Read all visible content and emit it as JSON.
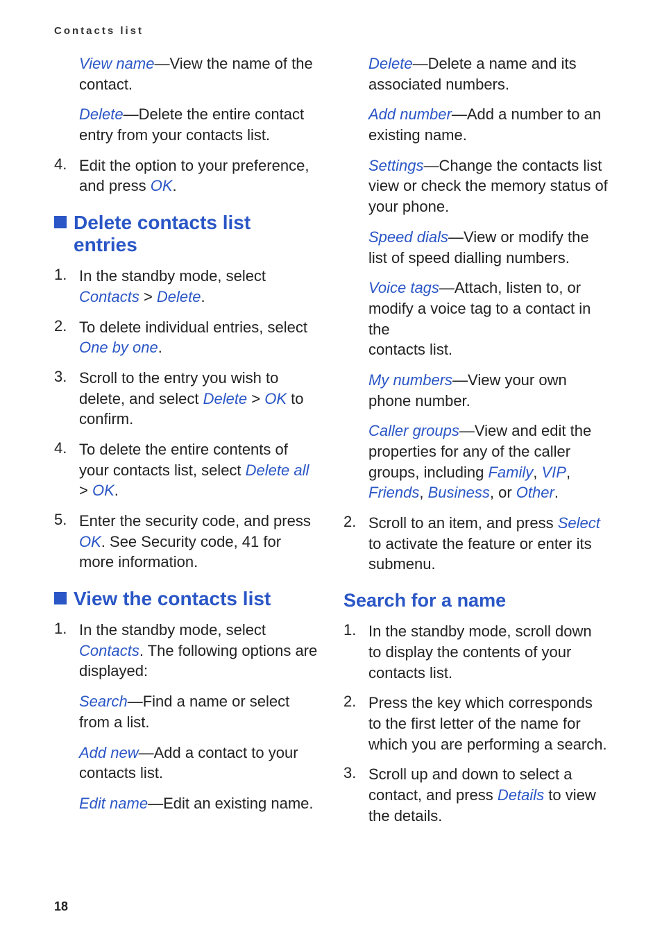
{
  "header": "Contacts list",
  "page_number": "18",
  "left": {
    "p1": {
      "term": "View name",
      "text": "—View the name of the contact."
    },
    "p2": {
      "term": "Delete",
      "text": "—Delete the entire contact entry from your contacts list."
    },
    "n4": {
      "num": "4.",
      "t1": "Edit the option to your preference, and press ",
      "ok": "OK",
      "t2": "."
    },
    "h_delete": "Delete contacts list entries",
    "d1": {
      "num": "1.",
      "t1": "In the standby mode, select ",
      "contacts": "Contacts",
      "gt": " > ",
      "delete": "Delete",
      "t2": "."
    },
    "d2": {
      "num": "2.",
      "t1": "To delete individual entries, select ",
      "one": "One by one",
      "t2": "."
    },
    "d3": {
      "num": "3.",
      "t1": "Scroll to the entry you wish to delete, and select ",
      "delete": "Delete",
      "gt": " > ",
      "ok": "OK",
      "t2": " to confirm."
    },
    "d4": {
      "num": "4.",
      "t1": "To delete the entire contents of your contacts list, select ",
      "da": "Delete all",
      "gt": " > ",
      "ok": "OK",
      "t2": "."
    },
    "d5": {
      "num": "5.",
      "t1": "Enter the security code, and press ",
      "ok": "OK",
      "t2": ". See Security code, 41 for more information."
    },
    "h_view": "View the contacts list",
    "v1": {
      "num": "1.",
      "t1": "In the standby mode, select ",
      "contacts": "Contacts",
      "t2": ". The following options are displayed:"
    },
    "vp1": {
      "term": "Search",
      "text": "—Find a name or select from a list."
    },
    "vp2": {
      "term": "Add new",
      "text": "—Add a contact to your contacts list."
    },
    "vp3": {
      "term": "Edit name",
      "text": "—Edit an existing name."
    }
  },
  "right": {
    "rp1": {
      "term": "Delete",
      "text": "—Delete a name and its associated numbers."
    },
    "rp2": {
      "term": "Add number",
      "text": "—Add a number to an existing name."
    },
    "rp3": {
      "term": "Settings",
      "text": "—Change the contacts list view or check the memory status of your phone."
    },
    "rp4": {
      "term": "Speed dials",
      "text": "—View or modify the list of speed dialling numbers."
    },
    "rp5": {
      "term": "Voice tags",
      "text1": "—Attach, listen to, or modify a voice tag to a contact in the",
      "text2": "contacts list."
    },
    "rp6": {
      "term": "My numbers",
      "text": "—View your own phone number."
    },
    "rp7": {
      "term": "Caller groups",
      "t1": "—View and edit the properties for any of the caller groups, including ",
      "family": "Family",
      "c1": ", ",
      "vip": "VIP",
      "c2": ", ",
      "friends": "Friends",
      "c3": ", ",
      "business": "Business",
      "c4": ", or ",
      "other": "Other",
      "t2": "."
    },
    "r2": {
      "num": "2.",
      "t1": "Scroll to an item, and press ",
      "select": "Select",
      "t2": " to activate the feature or enter its submenu."
    },
    "h_search": "Search for a name",
    "s1": {
      "num": "1.",
      "text": "In the standby mode, scroll down to display the contents of your contacts list."
    },
    "s2": {
      "num": "2.",
      "text": "Press the key which corresponds to the first letter of the name for which you are performing a search."
    },
    "s3": {
      "num": "3.",
      "t1": "Scroll up and down to select a contact, and press ",
      "details": "Details",
      "t2": " to view the details."
    }
  }
}
